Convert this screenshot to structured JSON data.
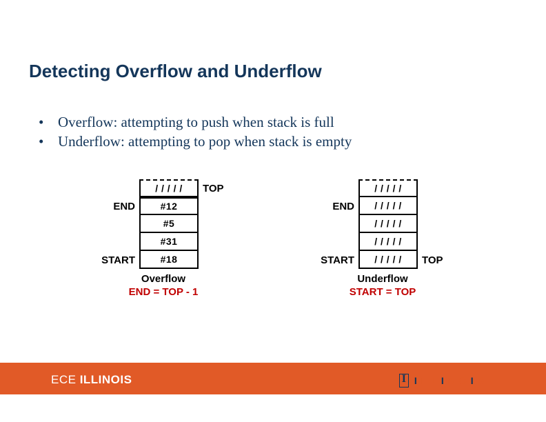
{
  "title": "Detecting Overflow and Underflow",
  "bullets": [
    "Overflow: attempting to push when stack is full",
    "Underflow: attempting to pop when stack is empty"
  ],
  "overflow_diagram": {
    "rows": [
      {
        "left": "",
        "cell": "/ / / / /",
        "right": "TOP"
      },
      {
        "left": "END",
        "cell": "#12",
        "right": ""
      },
      {
        "left": "",
        "cell": "#5",
        "right": ""
      },
      {
        "left": "",
        "cell": "#31",
        "right": ""
      },
      {
        "left": "START",
        "cell": "#18",
        "right": ""
      }
    ],
    "caption": "Overflow",
    "formula": "END = TOP - 1"
  },
  "underflow_diagram": {
    "rows": [
      {
        "left": "",
        "cell": "/ / / / /",
        "right": ""
      },
      {
        "left": "END",
        "cell": "/ / / / /",
        "right": ""
      },
      {
        "left": "",
        "cell": "/ / / / /",
        "right": ""
      },
      {
        "left": "",
        "cell": "/ / / / /",
        "right": ""
      },
      {
        "left": "START",
        "cell": "/ / / / /",
        "right": "TOP"
      }
    ],
    "caption": "Underflow",
    "formula": "START = TOP"
  },
  "footer": {
    "left_thin": "ECE ",
    "left_bold": "ILLINOIS",
    "wordmark": "ILLINOIS"
  }
}
